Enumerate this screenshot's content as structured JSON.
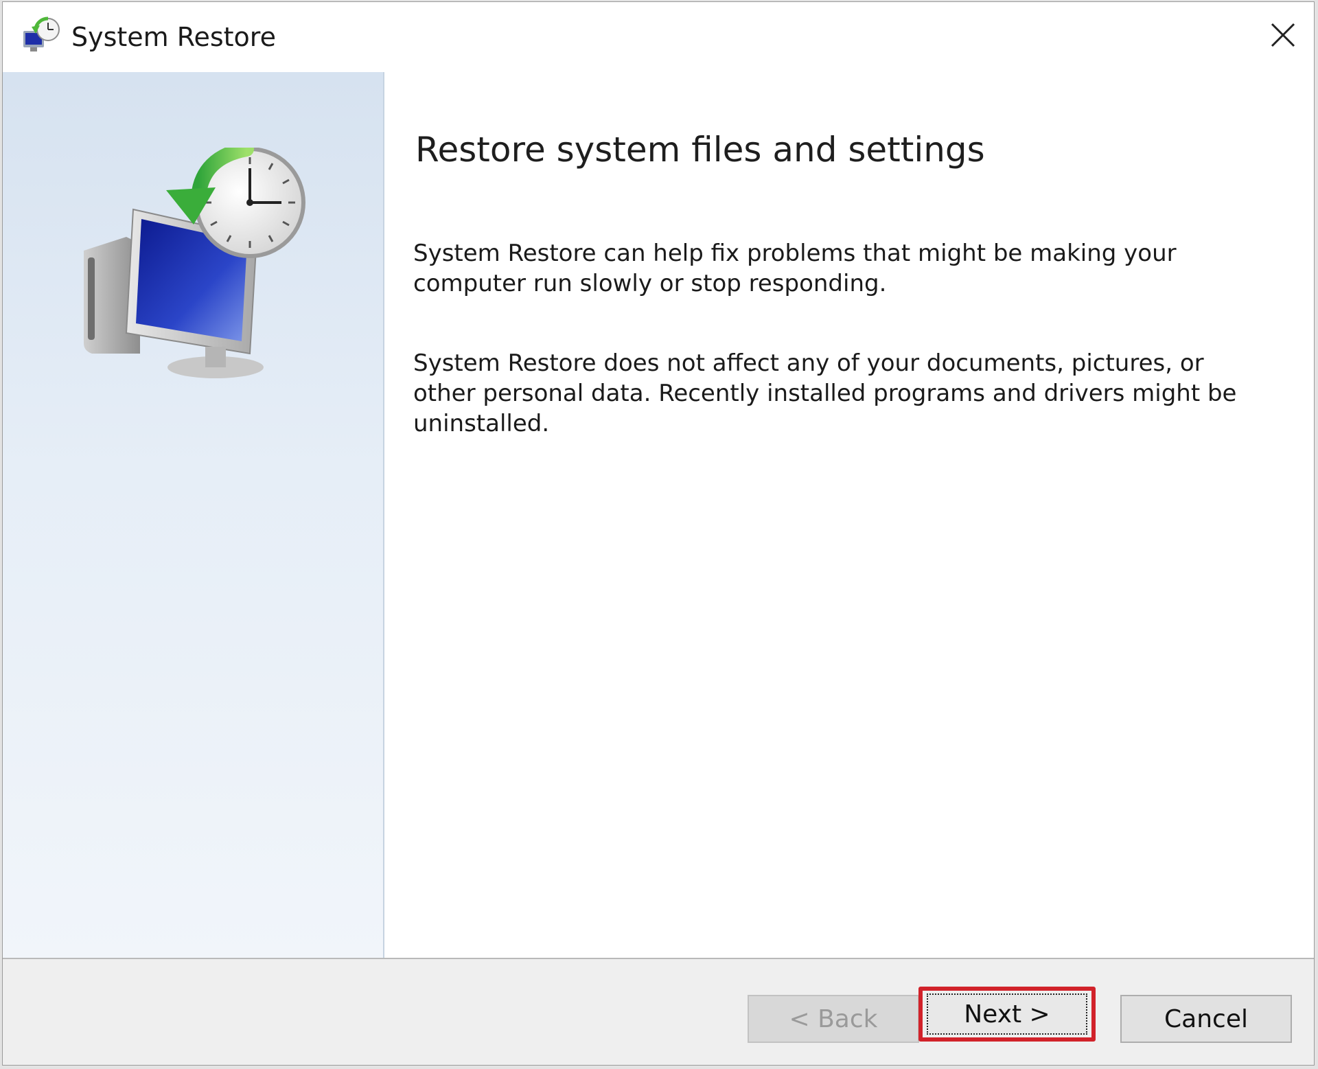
{
  "window": {
    "title": "System Restore",
    "icon": "system-restore-icon",
    "close_icon": "close-icon"
  },
  "main": {
    "heading": "Restore system files and settings",
    "paragraph_1": "System Restore can help fix problems that might be making your computer run slowly or stop responding.",
    "paragraph_2": "System Restore does not affect any of your documents, pictures, or other personal data. Recently installed programs and drivers might be uninstalled.",
    "illustration": "computer-with-restore-clock-icon"
  },
  "footer": {
    "back_label": "< Back",
    "next_label": "Next >",
    "cancel_label": "Cancel",
    "back_enabled": false,
    "highlight_color": "#d1222a"
  },
  "colors": {
    "panel_gradient_top": "#d6e2f0",
    "panel_gradient_bottom": "#f1f5fa",
    "screen_blue": "#1f2fa8",
    "arrow_green": "#4fb83a"
  }
}
